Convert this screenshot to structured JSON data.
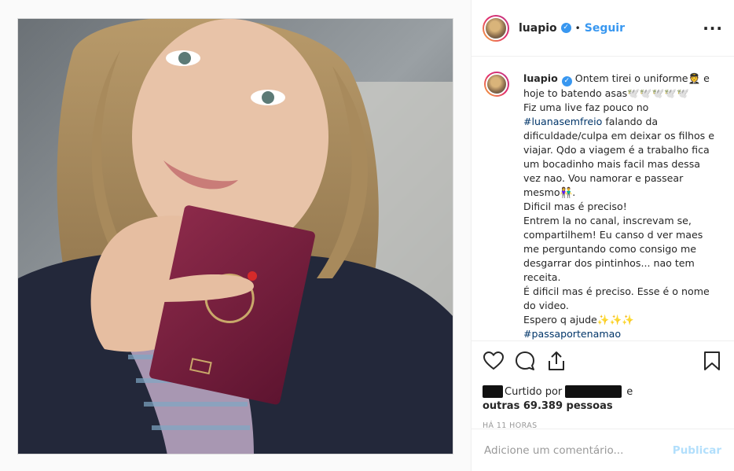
{
  "post": {
    "username": "luapio",
    "verified_icon": "verified-badge-icon",
    "follow_label": "Seguir",
    "more_icon": "more-options-icon",
    "caption_lines": [
      "Ontem tirei o uniforme🧑‍✈️ e",
      "hoje to batendo asas🕊️🕊️🕊️🕊️🕊️",
      "Fiz uma live faz pouco no",
      "#luanasemfreio",
      " falando da",
      "dificuldade/culpa em deixar os filhos e",
      "viajar. Qdo a viagem é a trabalho fica",
      "um bocadinho mais facil mas dessa",
      "vez nao. Vou namorar e passear",
      "mesmo👫.",
      "Dificil mas é preciso!",
      "Entrem la no canal, inscrevam se,",
      "compartilhem! Eu canso d ver maes",
      "me perguntando como consigo me",
      "desgarrar dos pintinhos... nao tem",
      "receita.",
      "É dificil mas é preciso. Esse é o nome",
      "do video.",
      "Espero q ajude✨✨✨",
      "#passaportenamao"
    ],
    "likes_prefix": "Curtido por",
    "likes_conj": "e",
    "likes_others": "outras 69.389 pessoas",
    "timestamp": "HÁ 11 HORAS",
    "comment_placeholder": "Adicione um comentário...",
    "publish_label": "Publicar"
  },
  "colors": {
    "accent": "#3897f0",
    "hashtag": "#003569",
    "publish_disabled": "#b2dffc"
  }
}
